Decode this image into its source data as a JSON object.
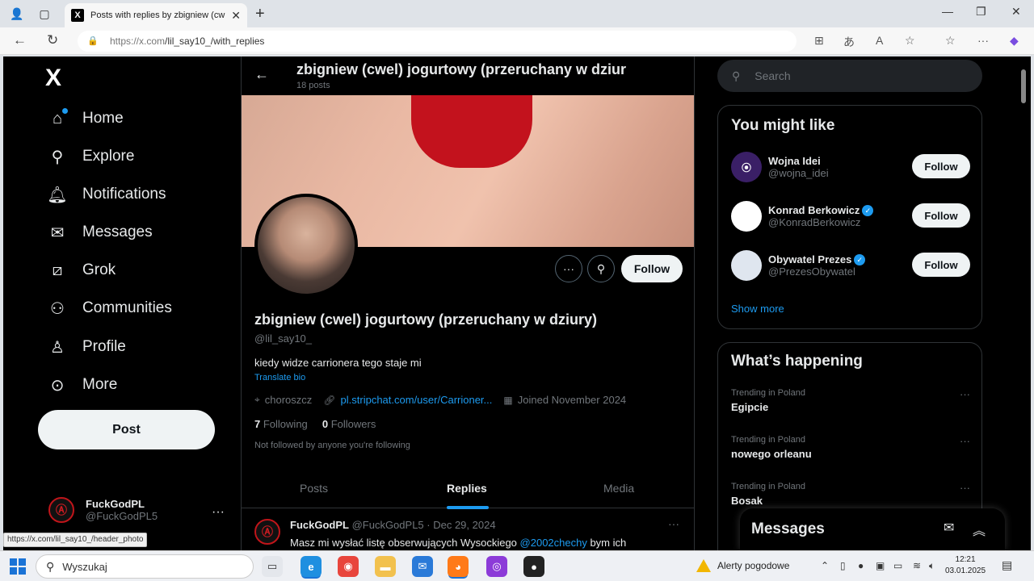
{
  "browser": {
    "tab_title": "Posts with replies by zbigniew (cw",
    "tab_favicon": "X",
    "url_host": "https://x.com",
    "url_path": "/lil_say10_/with_replies",
    "status_url": "https://x.com/lil_say10_/header_photo"
  },
  "nav": {
    "logo": "X",
    "items": [
      {
        "label": "Home",
        "icon": "home-icon"
      },
      {
        "label": "Explore",
        "icon": "search-icon"
      },
      {
        "label": "Notifications",
        "icon": "bell-icon"
      },
      {
        "label": "Messages",
        "icon": "envelope-icon"
      },
      {
        "label": "Grok",
        "icon": "grok-icon"
      },
      {
        "label": "Communities",
        "icon": "people-icon"
      },
      {
        "label": "Profile",
        "icon": "person-icon"
      },
      {
        "label": "More",
        "icon": "more-circle-icon"
      }
    ],
    "post_label": "Post",
    "account": {
      "name": "FuckGodPL",
      "handle": "@FuckGodPL5"
    }
  },
  "profile": {
    "header_title": "zbigniew (cwel) jogurtowy (przeruchany w dziur",
    "header_posts": "18 posts",
    "follow_label": "Follow",
    "name": "zbigniew (cwel) jogurtowy (przeruchany w dziury)",
    "handle": "@lil_say10_",
    "bio": "kiedy widze carrionera tego staje mi",
    "translate": "Translate bio",
    "location": "choroszcz",
    "link": "pl.stripchat.com/user/Carrioner...",
    "joined": "Joined November 2024",
    "following_count": "7",
    "following_label": "Following",
    "followers_count": "0",
    "followers_label": "Followers",
    "note": "Not followed by anyone you're following",
    "tabs": [
      "Posts",
      "Replies",
      "Media"
    ],
    "active_tab": "Replies"
  },
  "tweet": {
    "name": "FuckGodPL",
    "handle": "@FuckGodPL5",
    "date": "· Dec 29, 2024",
    "text": "Masz mi wysłać listę obserwujących Wysockiego ",
    "mention": "@2002chechy",
    "text_tail": " bym ich"
  },
  "sidebar": {
    "search_placeholder": "Search",
    "you_might_like": "You might like",
    "suggestions": [
      {
        "name": "Wojna Idei",
        "handle": "@wojna_idei",
        "verified": false,
        "color": "#3a1f66"
      },
      {
        "name": "Konrad Berkowicz",
        "handle": "@KonradBerkowicz",
        "verified": true,
        "color": "#ffffff"
      },
      {
        "name": "Obywatel Prezes",
        "handle": "@PrezesObywatel",
        "verified": true,
        "color": "#dfe6ef"
      }
    ],
    "follow_label": "Follow",
    "show_more": "Show more",
    "whats_happening": "What’s happening",
    "trends": [
      {
        "context": "Trending in Poland",
        "name": "Egipcie"
      },
      {
        "context": "Trending in Poland",
        "name": "nowego orleanu"
      },
      {
        "context": "Trending in Poland",
        "name": "Bosak"
      }
    ],
    "messages_label": "Messages"
  },
  "taskbar": {
    "search_placeholder": "Wyszukaj",
    "weather": "Alerty pogodowe",
    "time": "12:21",
    "date": "03.01.2025"
  }
}
